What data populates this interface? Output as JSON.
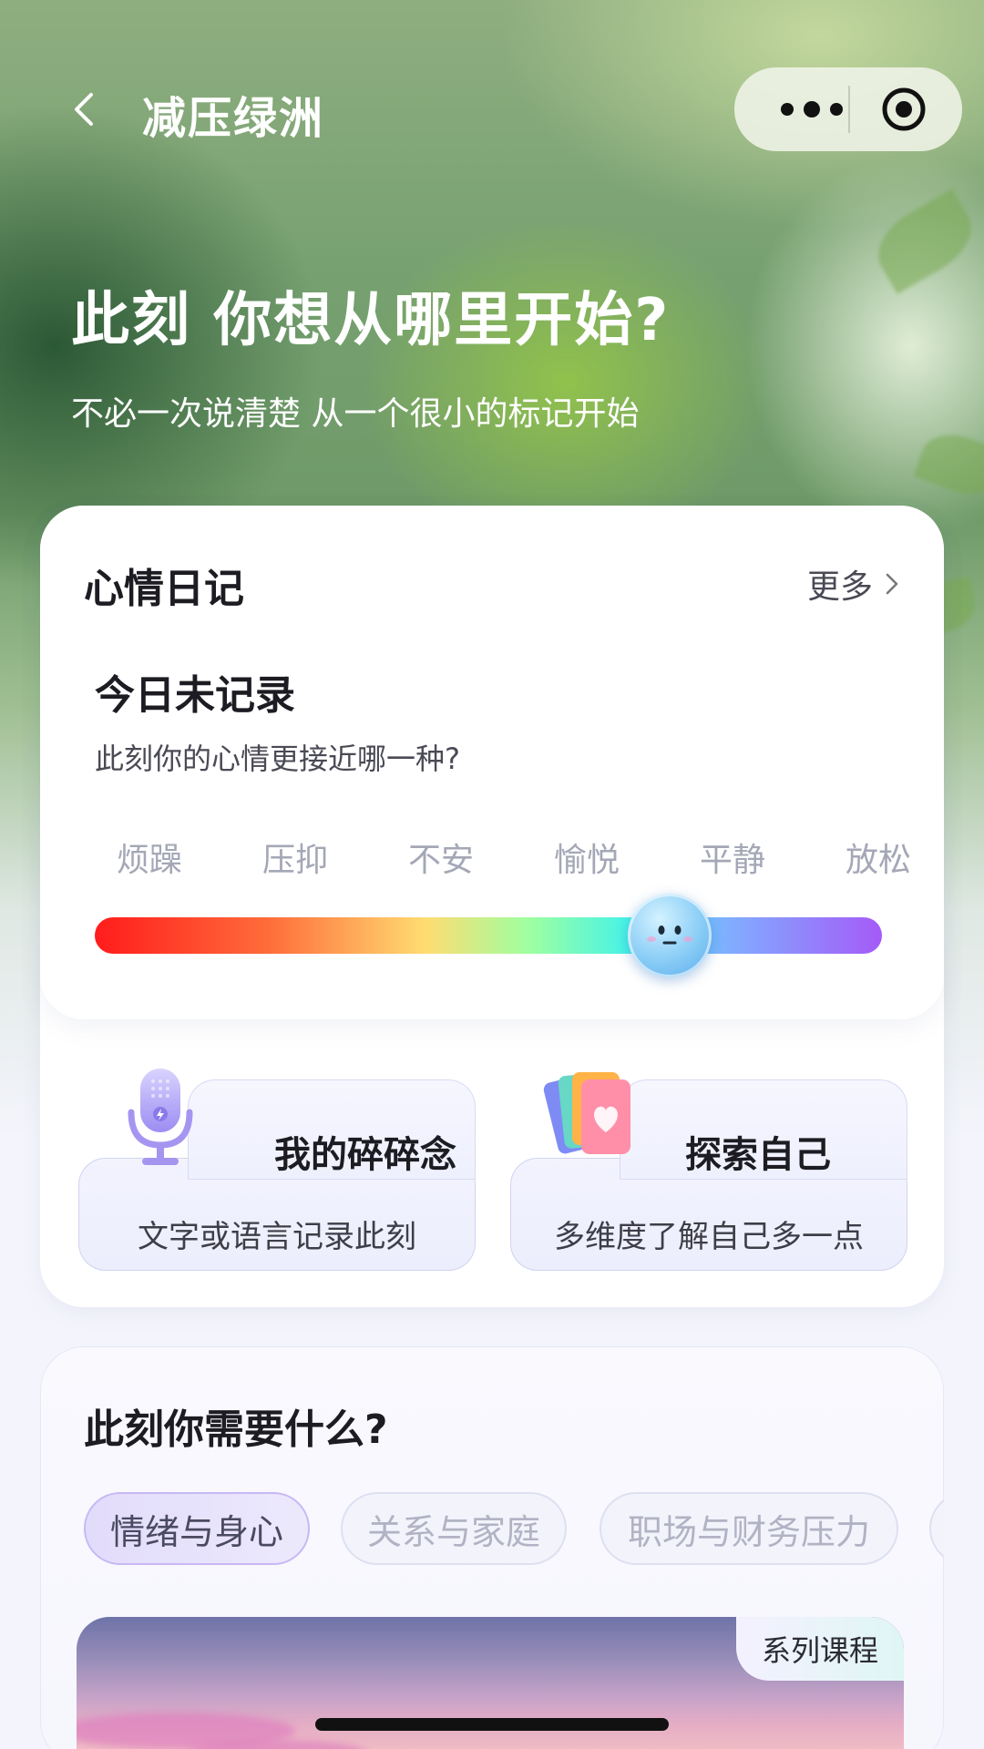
{
  "nav": {
    "title": "减压绿洲",
    "back_icon": "chevron-left-icon",
    "more_icon": "more-dots-icon",
    "close_icon": "target-circle-icon"
  },
  "hero": {
    "headline": "此刻 你想从哪里开始?",
    "subline": "不必一次说清楚 从一个很小的标记开始"
  },
  "mood_diary": {
    "title": "心情日记",
    "more_label": "更多",
    "today_title": "今日未记录",
    "today_prompt": "此刻你的心情更接近哪一种?",
    "mood_labels": [
      "烦躁",
      "压抑",
      "不安",
      "愉悦",
      "平静",
      "放松"
    ],
    "slider_value": 0.73,
    "slider_colors": [
      "#ff1c1c",
      "#ff6c3a",
      "#ffdc72",
      "#9fffa0",
      "#45f3e8",
      "#7fb0ff",
      "#a55af8"
    ]
  },
  "entries": [
    {
      "title": "我的碎碎念",
      "desc": "文字或语言记录此刻",
      "icon": "microphone-icon"
    },
    {
      "title": "探索自己",
      "desc": "多维度了解自己多一点",
      "icon": "heart-cards-icon"
    }
  ],
  "needs": {
    "title": "此刻你需要什么?",
    "chips": [
      "情绪与身心",
      "关系与家庭",
      "职场与财务压力"
    ],
    "active_chip": "情绪与身心",
    "course_badge": "系列课程"
  }
}
